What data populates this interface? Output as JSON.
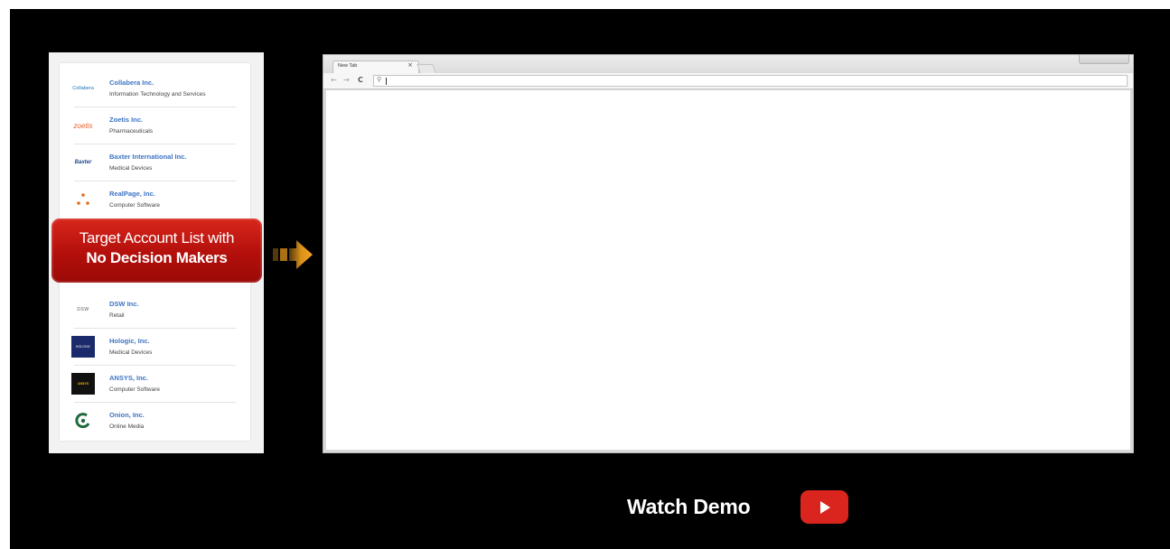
{
  "companies_top": [
    {
      "name": "Collabera Inc.",
      "industry": "Information Technology and Services",
      "logo_text": "Collabera",
      "logo_color": "#1a75bb"
    },
    {
      "name": "Zoetis Inc.",
      "industry": "Pharmaceuticals",
      "logo_text": "zoetis",
      "logo_color": "#e8602c"
    },
    {
      "name": "Baxter International Inc.",
      "industry": "Medical Devices",
      "logo_text": "Baxter",
      "logo_color": "#1b4a8c"
    },
    {
      "name": "RealPage, Inc.",
      "industry": "Computer Software",
      "logo_text": "",
      "logo_color": "#e06f1f"
    }
  ],
  "companies_bottom": [
    {
      "name": "DSW Inc.",
      "industry": "Retail",
      "logo_text": "DSW",
      "logo_color": "#555555"
    },
    {
      "name": "Hologic, Inc.",
      "industry": "Medical Devices",
      "logo_text": "HOLOGIC",
      "logo_color": "#1b2a6b"
    },
    {
      "name": "ANSYS, Inc.",
      "industry": "Computer Software",
      "logo_text": "ANSYS",
      "logo_color": "#111111"
    },
    {
      "name": "Onion, Inc.",
      "industry": "Online Media",
      "logo_text": "",
      "logo_color": "#1d6b3a"
    }
  ],
  "callout": {
    "line1": "Target Account List with",
    "line2": "No Decision Makers",
    "color": "#c0140f"
  },
  "arrow_color": "#f2a01d",
  "browser": {
    "tab_title": "New Tab",
    "tab_close": "×",
    "nav_back": "←",
    "nav_forward": "→",
    "nav_reload": "C",
    "omnibox_icon": "⚲"
  },
  "cta": {
    "label": "Watch Demo",
    "play_color": "#d9251d"
  }
}
